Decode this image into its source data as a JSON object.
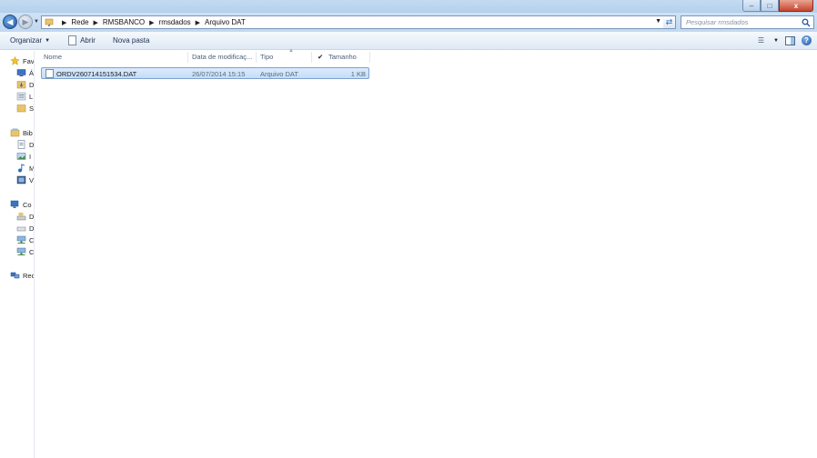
{
  "window": {
    "title": "",
    "controls": {
      "minimize": "–",
      "maximize": "□",
      "close": "x"
    }
  },
  "address": {
    "crumbs": [
      "Rede",
      "RMSBANCO",
      "rmsdados",
      "Arquivo DAT"
    ],
    "refresh_glyph": "⇄",
    "search_placeholder": "Pesquisar rmsdados"
  },
  "toolbar": {
    "organize_label": "Organizar",
    "open_label": "Abrir",
    "new_folder_label": "Nova pasta"
  },
  "navpane": {
    "favorites": [
      "Fav",
      "Á",
      "D",
      "L",
      "S"
    ],
    "libraries": [
      "Bib",
      "D",
      "I",
      "M",
      "V"
    ],
    "computer": [
      "Co",
      "D",
      "D",
      "C",
      "C"
    ],
    "network": "Rec"
  },
  "columns": {
    "name": "Nome",
    "date": "Data de modificaç...",
    "type": "Tipo",
    "size_check": "✔",
    "size": "Tamanho"
  },
  "files": [
    {
      "name": "ORDV260714151534.DAT",
      "date": "26/07/2014 15:15",
      "type": "Arquivo DAT",
      "size": "1 KB",
      "selected": true
    }
  ],
  "colors": {
    "selection_fill": "#cfe3fa",
    "selection_border": "#7da2ce",
    "chrome": "#c4dbf1"
  }
}
